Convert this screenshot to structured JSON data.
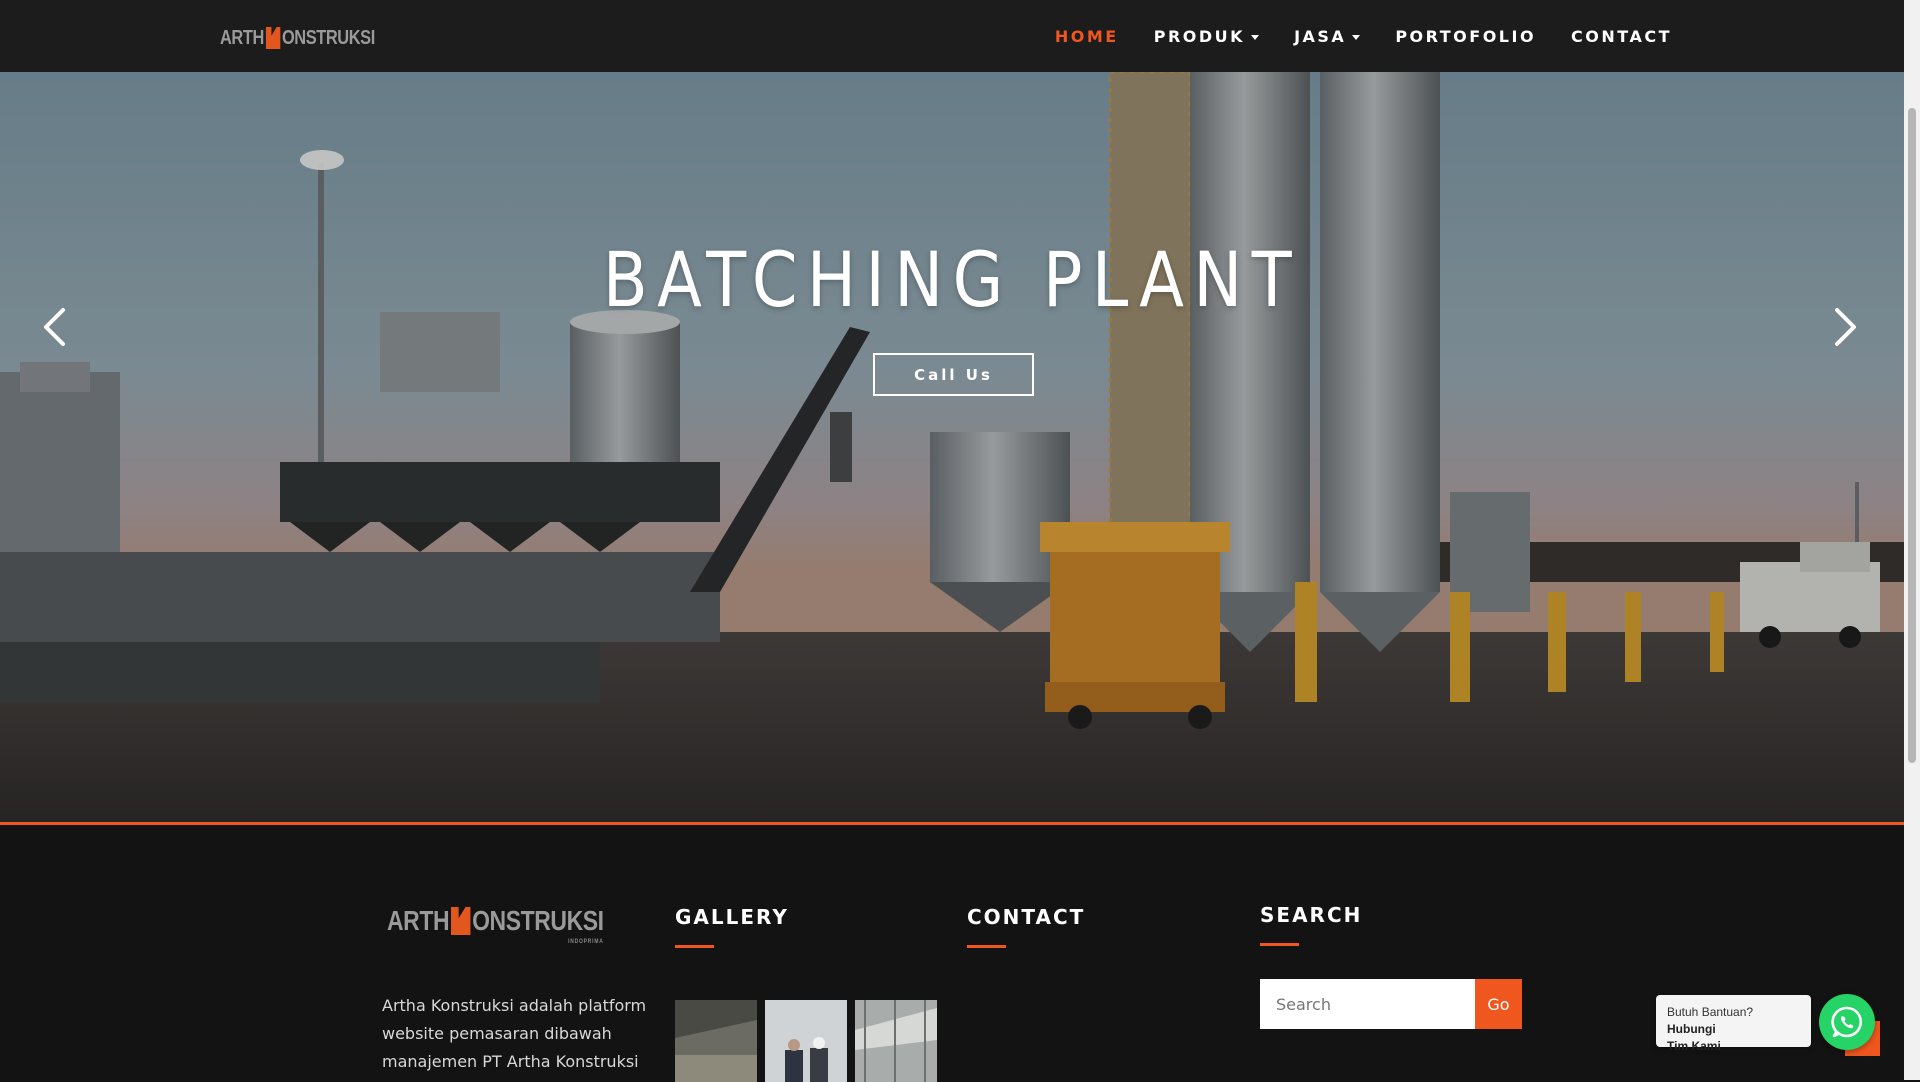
{
  "brand": {
    "logo_text_left": "ARTH",
    "logo_text_right": "ONSTRUKSI",
    "logo_sub": "INDOPRIMA"
  },
  "nav": {
    "items": [
      {
        "label": "HOME",
        "active": true,
        "dropdown": false
      },
      {
        "label": "PRODUK",
        "active": false,
        "dropdown": true
      },
      {
        "label": "JASA",
        "active": false,
        "dropdown": true
      },
      {
        "label": "PORTOFOLIO",
        "active": false,
        "dropdown": false
      },
      {
        "label": "CONTACT",
        "active": false,
        "dropdown": false
      }
    ]
  },
  "hero": {
    "title": "BATCHING PLANT",
    "button_label": "Call Us",
    "prev_icon": "chevron-left-icon",
    "next_icon": "chevron-right-icon"
  },
  "footer": {
    "about_text": "Artha Konstruksi adalah platform website pemasaran dibawah manajemen PT Artha Konstruksi",
    "gallery_heading": "GALLERY",
    "contact_heading": "CONTACT",
    "search_heading": "SEARCH",
    "search_placeholder": "Search",
    "search_button": "Go"
  },
  "whatsapp": {
    "line1": "Butuh Bantuan? ",
    "line1_bold": "Hubungi",
    "line2_bold": "Tim Kami",
    "icon": "whatsapp-icon"
  },
  "colors": {
    "accent": "#f0571e",
    "navbar_bg": "#1c1c1c",
    "footer_bg": "#131313",
    "whatsapp": "#25d366"
  }
}
